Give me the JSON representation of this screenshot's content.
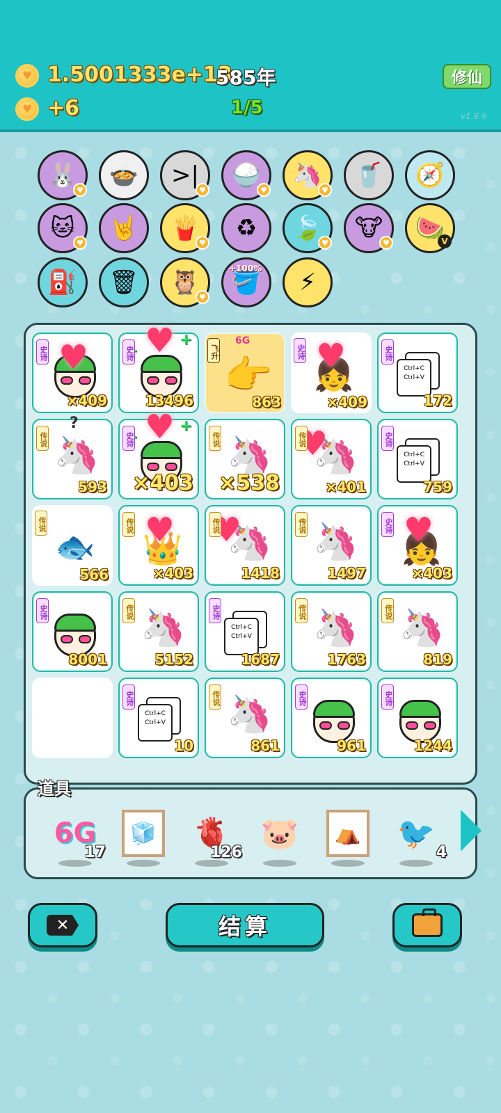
{
  "header": {
    "coins": "1.5001333e+13",
    "years": "585年",
    "income": "+6",
    "progress": "1/5",
    "cultivate_label": "修仙",
    "version": "v1.9.6"
  },
  "items_row1": [
    {
      "name": "rabbit-item-icon",
      "glyph": "🐰",
      "bg": "#c89be0",
      "badge": true
    },
    {
      "name": "pot-item-icon",
      "glyph": "🍲",
      "bg": "#f0f0f0",
      "badge": false
    },
    {
      "name": "skip-item-icon",
      "glyph": ">|",
      "bg": "#d8d8d8",
      "badge": true
    },
    {
      "name": "rice-bowl-item-icon",
      "glyph": "🍚",
      "bg": "#c89be0",
      "badge": true
    },
    {
      "name": "unicorn-item-icon",
      "glyph": "🦄",
      "bg": "#ffe36a",
      "badge": true
    },
    {
      "name": "cup-item-icon",
      "glyph": "🥤",
      "bg": "#d8d8d8",
      "badge": false
    },
    {
      "name": "compass-item-icon",
      "glyph": "🧭",
      "bg": "#bfe9f0",
      "badge": false
    }
  ],
  "items_row2": [
    {
      "name": "cat-item-icon",
      "glyph": "🐱",
      "bg": "#c89be0",
      "badge": true
    },
    {
      "name": "rock-hand-item-icon",
      "glyph": "🤘",
      "bg": "#c89be0",
      "badge": false
    },
    {
      "name": "fries-item-icon",
      "glyph": "🍟",
      "bg": "#ffe36a",
      "badge": true
    },
    {
      "name": "recycle-item-icon",
      "glyph": "♻",
      "bg": "#c89be0",
      "badge": false
    },
    {
      "name": "leaf-item-icon",
      "glyph": "🍃",
      "bg": "#6fd6e0",
      "badge": true
    },
    {
      "name": "cows-item-icon",
      "glyph": "🐮",
      "bg": "#c89be0",
      "badge": true
    },
    {
      "name": "fruit-basket-item-icon",
      "glyph": "🍉",
      "bg": "#ffe36a",
      "vbadge": "V"
    }
  ],
  "items_row3": [
    {
      "name": "pump-item-icon",
      "glyph": "⛽",
      "bg": "#6fd6e0",
      "badge": false
    },
    {
      "name": "trash-bag-item-icon",
      "glyph": "🗑",
      "bg": "#6fd6e0",
      "badge": false
    },
    {
      "name": "owls-item-icon",
      "glyph": "🦉",
      "bg": "#ffe36a",
      "badge": true
    },
    {
      "name": "bucket-item-icon",
      "glyph": "🪣",
      "bg": "#c89be0",
      "pct": "+100%"
    },
    {
      "name": "lightning-item-icon",
      "glyph": "⚡",
      "bg": "#ffe36a",
      "badge": false
    }
  ],
  "grid": [
    [
      {
        "type": "greenhead",
        "tag": "epic",
        "tag_text": "史诗",
        "count": "×409",
        "heart": true
      },
      {
        "type": "greenhead",
        "tag": "epic",
        "tag_text": "史诗",
        "count": "13496",
        "heart": true,
        "x": true
      },
      {
        "type": "hand",
        "tag": "fly",
        "tag_text": "飞升",
        "count": "863",
        "sixg": "6G"
      },
      {
        "type": "girl",
        "tag": "epic",
        "tag_text": "史诗",
        "count": "×409",
        "heart": true
      },
      {
        "type": "copy",
        "tag": "epic",
        "tag_text": "史诗",
        "count": "172"
      }
    ],
    [
      {
        "type": "unicorn",
        "tag": "legend",
        "tag_text": "传说",
        "count": "593",
        "question": "?"
      },
      {
        "type": "greenhead",
        "tag": "epic",
        "tag_text": "史诗",
        "count": "×403",
        "heart": true,
        "x": true,
        "big": true
      },
      {
        "type": "unicorn",
        "tag": "legend",
        "tag_text": "传说",
        "count": "×538",
        "big": true
      },
      {
        "type": "unicorn",
        "tag": "legend",
        "tag_text": "传说",
        "count": "×401",
        "heart": true
      },
      {
        "type": "copy",
        "tag": "epic",
        "tag_text": "史诗",
        "count": "759"
      }
    ],
    [
      {
        "type": "fish",
        "tag": "legend",
        "tag_text": "传说",
        "count": "566"
      },
      {
        "type": "king",
        "tag": "legend",
        "tag_text": "传说",
        "count": "×403",
        "heart": true
      },
      {
        "type": "unicorn",
        "tag": "legend",
        "tag_text": "传说",
        "count": "1418",
        "heart": true
      },
      {
        "type": "unicorn",
        "tag": "legend",
        "tag_text": "传说",
        "count": "1497"
      },
      {
        "type": "girl",
        "tag": "epic",
        "tag_text": "史诗",
        "count": "×403",
        "heart": true
      }
    ],
    [
      {
        "type": "greenhead",
        "tag": "epic",
        "tag_text": "史诗",
        "count": "8001"
      },
      {
        "type": "unicorn",
        "tag": "legend",
        "tag_text": "传说",
        "count": "5152"
      },
      {
        "type": "copy",
        "tag": "epic",
        "tag_text": "史诗",
        "count": "1687"
      },
      {
        "type": "unicorn",
        "tag": "legend",
        "tag_text": "传说",
        "count": "1763"
      },
      {
        "type": "unicorn",
        "tag": "legend",
        "tag_text": "传说",
        "count": "819"
      }
    ],
    [
      {
        "type": "empty"
      },
      {
        "type": "copy",
        "tag": "epic",
        "tag_text": "史诗",
        "count": "10"
      },
      {
        "type": "unicorn",
        "tag": "legend",
        "tag_text": "传说",
        "count": "861"
      },
      {
        "type": "greenhead",
        "tag": "epic",
        "tag_text": "史诗",
        "count": "961"
      },
      {
        "type": "greenhead",
        "tag": "epic",
        "tag_text": "史诗",
        "count": "1244"
      }
    ]
  ],
  "copy_card_text": {
    "line1": "Ctrl+C",
    "line2": "Ctrl+V"
  },
  "tools": {
    "label": "道具",
    "items": [
      {
        "name": "6g-tool",
        "kind": "6g",
        "text": "6G",
        "count": "17"
      },
      {
        "name": "fridge-tool",
        "kind": "frame",
        "glyph": "🧊",
        "count": ""
      },
      {
        "name": "liver-tool",
        "kind": "glyph",
        "glyph": "🫀",
        "count": "126"
      },
      {
        "name": "piggy-bank-tool",
        "kind": "glyph",
        "glyph": "🐷",
        "count": ""
      },
      {
        "name": "tent-tool",
        "kind": "frame",
        "glyph": "⛺",
        "count": ""
      },
      {
        "name": "bird-tool",
        "kind": "glyph",
        "glyph": "🐦",
        "count": "4"
      }
    ]
  },
  "bottom": {
    "close_label": "✕",
    "settle_label": "结算"
  }
}
